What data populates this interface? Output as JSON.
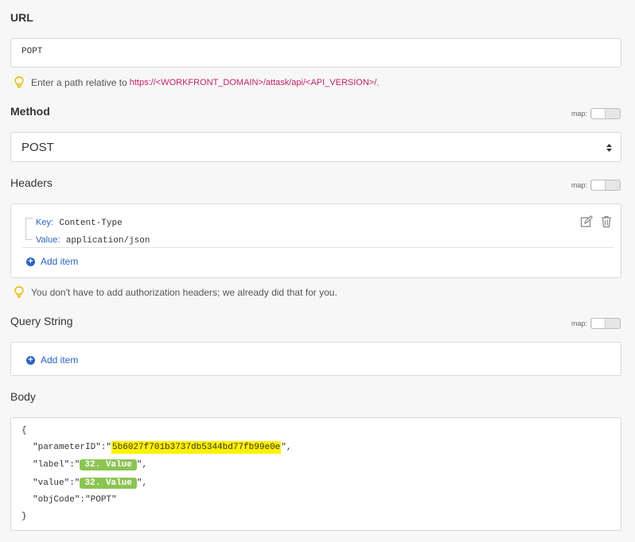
{
  "url": {
    "label": "URL",
    "value": "POPT",
    "hint_prefix": "Enter a path relative to ",
    "hint_link": "https://<WORKFRONT_DOMAIN>/attask/api/<API_VERSION>/",
    "hint_suffix": "."
  },
  "method": {
    "label": "Method",
    "map_label": "map:",
    "value": "POST"
  },
  "headers": {
    "label": "Headers",
    "map_label": "map:",
    "items": [
      {
        "key_label": "Key:",
        "key": "Content-Type",
        "value_label": "Value:",
        "value": "application/json"
      }
    ],
    "add_item": "Add item",
    "hint": "You don't have to add authorization headers; we already did that for you."
  },
  "query": {
    "label": "Query String",
    "map_label": "map:",
    "add_item": "Add item"
  },
  "body": {
    "label": "Body",
    "open_brace": "{",
    "close_brace": "}",
    "line1_key": "\"parameterID\":\"",
    "line1_value": "5b6027f701b3737db5344bd77fb99e0e",
    "line1_end": "\",",
    "line2_key": "\"label\":\"",
    "line2_pill": "32. Value",
    "line2_end": "\",",
    "line3_key": "\"value\":\"",
    "line3_pill": "32. Value",
    "line3_end": "\",",
    "line4": "\"objCode\":\"POPT\""
  },
  "colors": {
    "accent_link": "#2a63c4",
    "hint_link": "#c2216b",
    "pill": "#8cc452",
    "highlight": "#fff200"
  }
}
